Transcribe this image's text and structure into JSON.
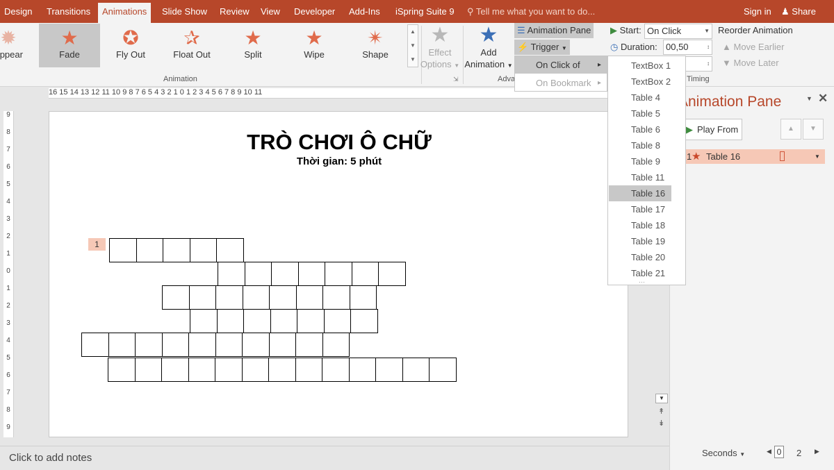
{
  "tabs": [
    {
      "label": "Design",
      "active": false
    },
    {
      "label": "Transitions",
      "active": false
    },
    {
      "label": "Animations",
      "active": true
    },
    {
      "label": "Slide Show",
      "active": false
    },
    {
      "label": "Review",
      "active": false
    },
    {
      "label": "View",
      "active": false
    },
    {
      "label": "Developer",
      "active": false
    },
    {
      "label": "Add-Ins",
      "active": false
    },
    {
      "label": "iSpring Suite 9",
      "active": false
    }
  ],
  "tell_me": "Tell me what you want to do...",
  "sign_in": "Sign in",
  "share": "Share",
  "gallery": [
    {
      "label": "Appear",
      "icon": "appear-star-icon"
    },
    {
      "label": "Fade",
      "icon": "fade-star-icon",
      "selected": true
    },
    {
      "label": "Fly Out",
      "icon": "fly-out-star-icon"
    },
    {
      "label": "Float Out",
      "icon": "float-out-star-icon"
    },
    {
      "label": "Split",
      "icon": "split-star-icon"
    },
    {
      "label": "Wipe",
      "icon": "wipe-star-icon"
    },
    {
      "label": "Shape",
      "icon": "shape-star-icon"
    }
  ],
  "animation_group_label": "Animation",
  "effect_options": {
    "line1": "Effect",
    "line2": "Options"
  },
  "add_animation": {
    "line1": "Add",
    "line2": "Animation"
  },
  "advanced_group_label": "Adva",
  "animation_pane_btn": "Animation Pane",
  "trigger_btn": "Trigger",
  "start_label": "Start:",
  "start_value": "On Click",
  "duration_label": "Duration:",
  "duration_value": "00,50",
  "timing_group_label": "Timing",
  "reorder_label": "Reorder Animation",
  "move_earlier": "Move Earlier",
  "move_later": "Move Later",
  "trigger_menu": [
    {
      "label": "On Click of",
      "highlighted": true
    },
    {
      "label": "On Bookmark",
      "highlighted": false,
      "disabled": true
    }
  ],
  "trigger_submenu": [
    "TextBox 1",
    "TextBox 2",
    "Table 4",
    "Table 5",
    "Table 6",
    "Table 8",
    "Table 9",
    "Table 11",
    "Table 16",
    "Table 17",
    "Table 18",
    "Table 19",
    "Table 20",
    "Table 21"
  ],
  "trigger_submenu_selected": "Table 16",
  "ruler_h": "16  15  14  13  12  11  10  9  8  7  6  5  4  3  2  1  0  1  2  3  4  5  6  7  8  9  10  11",
  "ruler_v": [
    "9",
    "8",
    "7",
    "6",
    "5",
    "4",
    "3",
    "2",
    "1",
    "0",
    "1",
    "2",
    "3",
    "4",
    "5",
    "6",
    "7",
    "8",
    "9"
  ],
  "slide": {
    "title": "TRÒ CHƠI Ô CHỮ",
    "subtitle": "Thời gian: 5 phút",
    "row_tag": "1",
    "crossword_rows": [
      5,
      7,
      8,
      7,
      10,
      13
    ]
  },
  "notes_placeholder": "Click to add notes",
  "pane": {
    "title": "Animation Pane",
    "play_from": "Play From",
    "item_index": "1",
    "item_label": "Table 16",
    "seconds_label": "Seconds",
    "time_start": "0",
    "time_end": "2"
  },
  "colors": {
    "accent": "#b7472a",
    "highlight": "#f6c8b6",
    "star": "#e06b4b"
  }
}
